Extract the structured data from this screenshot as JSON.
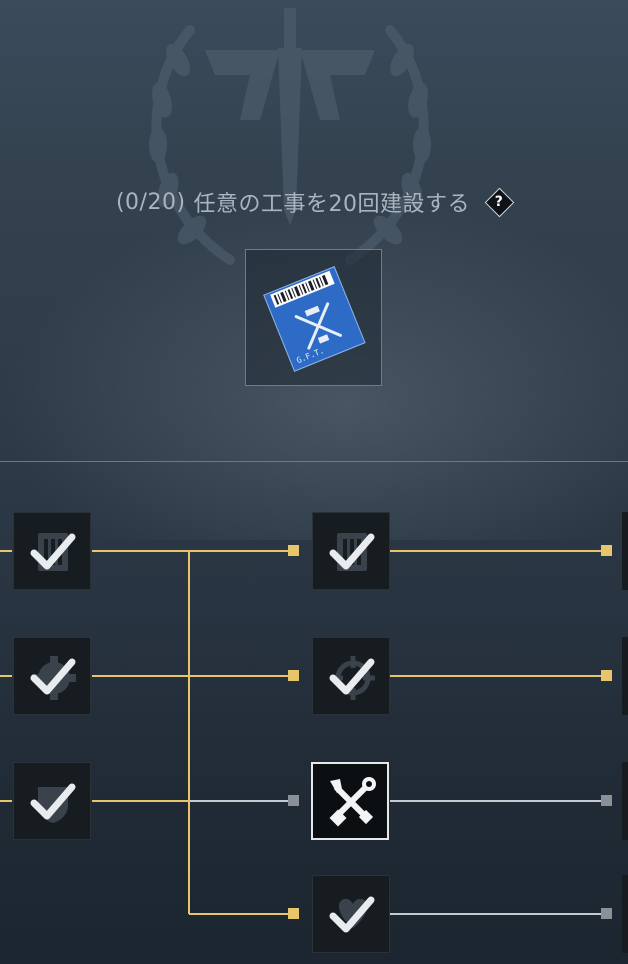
{
  "task": {
    "progress_text": "(0/20)",
    "description": "任意の工事を20回建設する",
    "help_glyph": "?"
  },
  "reward": {
    "item_icon": "blue-blueprint-card-icon",
    "card_label": "G.F.T."
  },
  "tree": {
    "columns": [
      {
        "nodes": [
          {
            "id": "l1",
            "icon": "barricade-icon",
            "state": "completed"
          },
          {
            "id": "l2",
            "icon": "gear-icon",
            "state": "completed"
          },
          {
            "id": "l3",
            "icon": "shield-icon",
            "state": "completed"
          }
        ]
      },
      {
        "nodes": [
          {
            "id": "m1",
            "icon": "barricade-icon",
            "state": "completed"
          },
          {
            "id": "m2",
            "icon": "crosshair-icon",
            "state": "completed"
          },
          {
            "id": "m3",
            "icon": "wrench-screwdriver-icon",
            "state": "selected"
          },
          {
            "id": "m4",
            "icon": "shield-heart-icon",
            "state": "completed"
          }
        ]
      }
    ],
    "colors": {
      "completed_line": "#e8c46a",
      "pending_line": "#c5cad0",
      "node_bg": "#171c21",
      "check": "#e9ecef"
    }
  }
}
